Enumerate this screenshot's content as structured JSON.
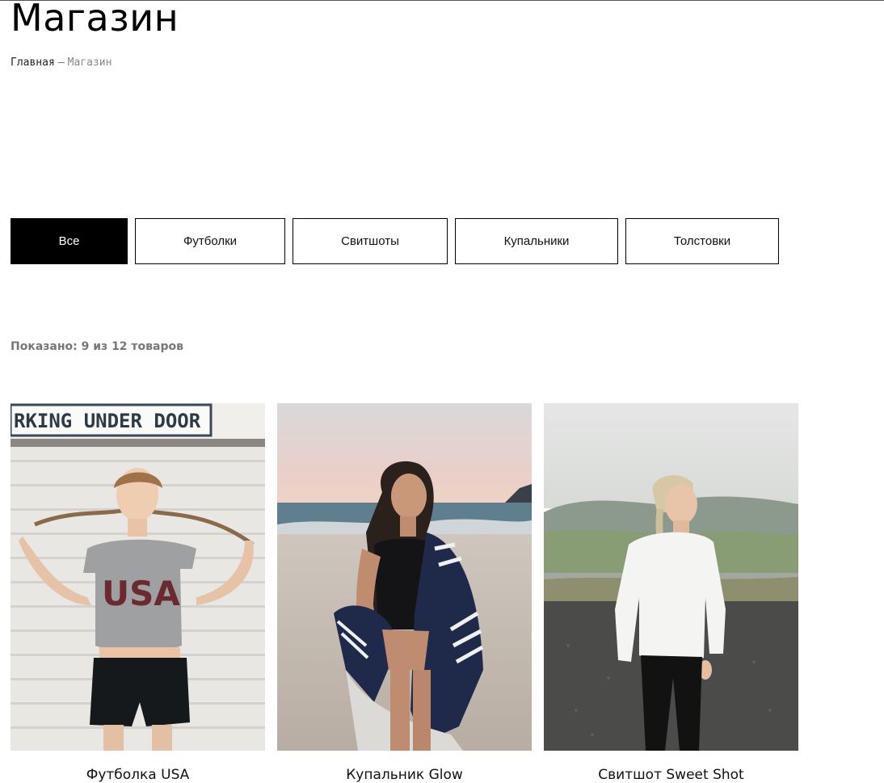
{
  "page": {
    "title": "Магазин"
  },
  "breadcrumb": {
    "home": "Главная",
    "separator": "—",
    "current": "Магазин"
  },
  "filters": [
    {
      "label": "Все",
      "active": true
    },
    {
      "label": "Футболки",
      "active": false
    },
    {
      "label": "Свитшоты",
      "active": false
    },
    {
      "label": "Купальники",
      "active": false
    },
    {
      "label": "Толстовки",
      "active": false
    }
  ],
  "results": {
    "count_text": "Показано: 9 из 12 товаров"
  },
  "products": [
    {
      "name": "Футболка USA",
      "sign_text": "RKING UNDER DOOR",
      "shirt_text": "USA"
    },
    {
      "name": "Купальник Glow"
    },
    {
      "name": "Свитшот Sweet Shot"
    }
  ],
  "colors": {
    "active_filter_bg": "#000000",
    "border": "#000000",
    "muted_text": "#777777"
  }
}
